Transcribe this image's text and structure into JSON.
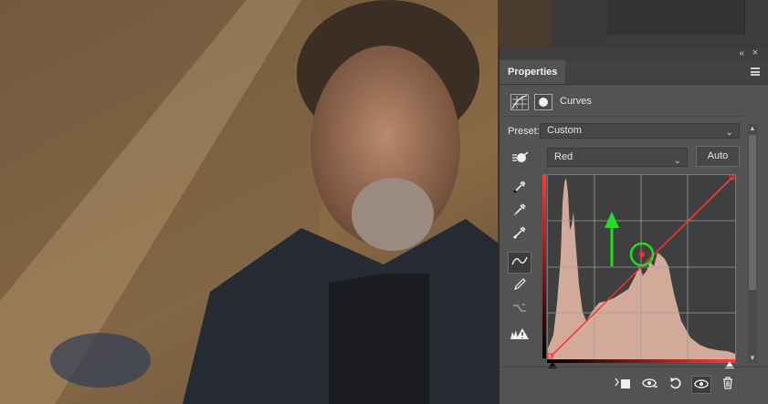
{
  "panel": {
    "title": "Properties",
    "adjustment_name": "Curves",
    "preset_label": "Preset:",
    "preset_value": "Custom",
    "channel_value": "Red",
    "auto_label": "Auto",
    "collapse_glyph": "«",
    "close_glyph": "×"
  },
  "tools": [
    "target-adjust-icon",
    "eyedropper-black-icon",
    "eyedropper-gray-icon",
    "eyedropper-white-icon",
    "curve-point-icon",
    "pencil-icon",
    "smooth-icon",
    "clipping-warning-icon"
  ],
  "bottom_icons": [
    "clip-to-layer-icon",
    "view-previous-icon",
    "reset-icon",
    "visibility-eye-icon",
    "trash-icon"
  ],
  "colors": {
    "panel_bg": "#535353",
    "histogram_fill": "#d3aa99",
    "curve_red": "#ff2a2a",
    "annotation_green": "#1ee01e"
  },
  "annotations": {
    "arrow": "green-up-arrow",
    "circle": "green-circle-highlight"
  },
  "curve": {
    "channel": "Red",
    "points": [
      [
        0,
        0
      ],
      [
        100,
        100
      ],
      [
        255,
        255
      ]
    ]
  }
}
